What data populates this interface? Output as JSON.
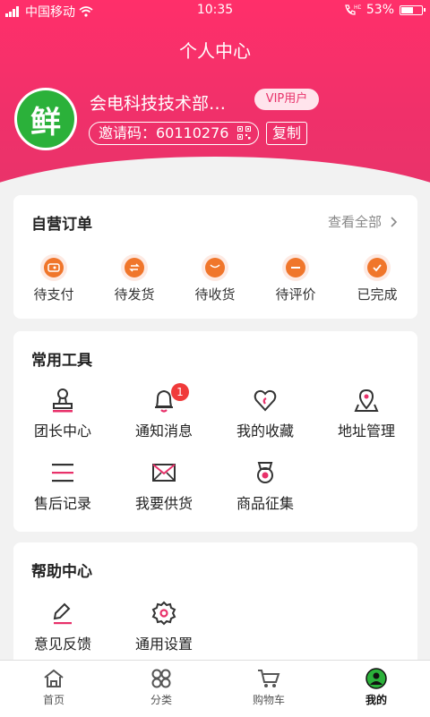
{
  "status_bar": {
    "carrier": "中国移动",
    "time": "10:35",
    "battery": "53%",
    "battery_level": 0.53
  },
  "header": {
    "title": "个人中心",
    "avatar_text": "鲜",
    "username": "会电科技技术部…",
    "vip_label": "VIP用户",
    "invite_label": "邀请码：60110276",
    "copy_label": "复制"
  },
  "orders": {
    "title": "自营订单",
    "view_all": "查看全部",
    "items": [
      {
        "label": "待支付",
        "icon": "wallet-icon"
      },
      {
        "label": "待发货",
        "icon": "exchange-icon"
      },
      {
        "label": "待收货",
        "icon": "box-icon"
      },
      {
        "label": "待评价",
        "icon": "comment-icon"
      },
      {
        "label": "已完成",
        "icon": "check-icon"
      }
    ]
  },
  "tools": {
    "title": "常用工具",
    "items": [
      {
        "label": "团长中心",
        "icon": "stamp-icon"
      },
      {
        "label": "通知消息",
        "icon": "bell-icon",
        "badge": "1"
      },
      {
        "label": "我的收藏",
        "icon": "heart-icon"
      },
      {
        "label": "地址管理",
        "icon": "map-pin-icon"
      },
      {
        "label": "售后记录",
        "icon": "list-icon"
      },
      {
        "label": "我要供货",
        "icon": "envelope-icon"
      },
      {
        "label": "商品征集",
        "icon": "medal-icon"
      }
    ]
  },
  "help": {
    "title": "帮助中心",
    "items": [
      {
        "label": "意见反馈",
        "icon": "edit-icon"
      },
      {
        "label": "通用设置",
        "icon": "gear-icon"
      }
    ]
  },
  "tabbar": {
    "items": [
      {
        "label": "首页",
        "icon": "home-icon"
      },
      {
        "label": "分类",
        "icon": "category-icon"
      },
      {
        "label": "购物车",
        "icon": "cart-icon"
      },
      {
        "label": "我的",
        "icon": "user-icon",
        "active": true
      }
    ]
  },
  "colors": {
    "brand": "#f0306a",
    "order_icon": "#f0762b",
    "badge": "#f03a3a",
    "active_tab": "#2bb13a"
  }
}
